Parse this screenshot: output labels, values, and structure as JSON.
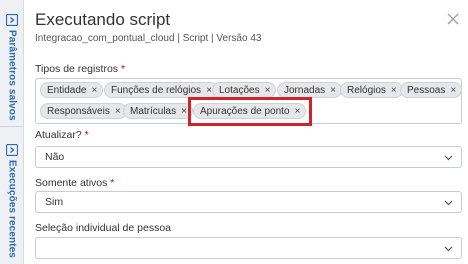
{
  "sidebar": {
    "tabs": [
      {
        "label": "Parâmetros salvos",
        "icon": "panel-expand-icon"
      },
      {
        "label": "Execuções recentes",
        "icon": "panel-expand-icon"
      }
    ]
  },
  "header": {
    "title": "Executando script",
    "subtitle": "Integracao_com_pontual_cloud | Script | Versão 43"
  },
  "form": {
    "tipos": {
      "label": "Tipos de registros",
      "required_mark": "*",
      "tags": [
        "Entidade",
        "Funções de relógios",
        "Lotações",
        "Jornadas",
        "Relógios",
        "Pessoas",
        "Responsáveis",
        "Matrículas",
        "Apurações de ponto"
      ],
      "remove_glyph": "×",
      "highlighted_tag": "Apurações de ponto"
    },
    "atualizar": {
      "label": "Atualizar?",
      "required_mark": "*",
      "value": "Não"
    },
    "somente_ativos": {
      "label": "Somente ativos",
      "required_mark": "*",
      "value": "Sim"
    },
    "selecao": {
      "label": "Seleção individual de pessoa",
      "value": ""
    }
  },
  "colors": {
    "accent": "#2c6bb0",
    "required": "#d0021b",
    "highlight": "#d0232a"
  }
}
